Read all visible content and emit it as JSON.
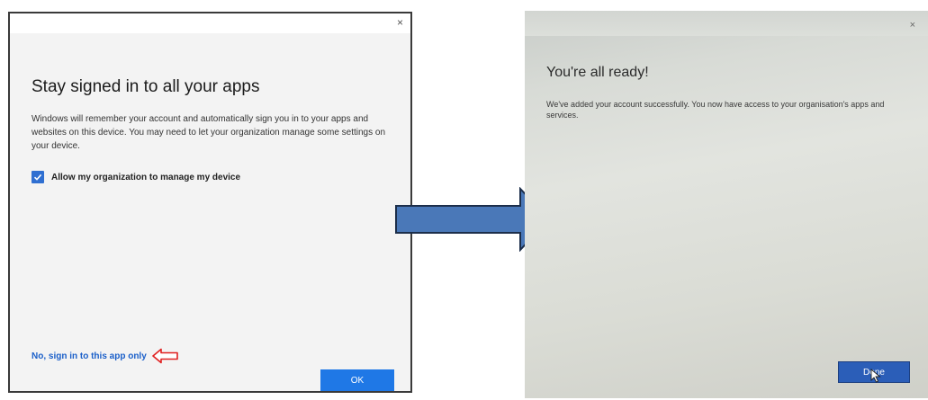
{
  "left_dialog": {
    "close_glyph": "×",
    "title": "Stay signed in to all your apps",
    "description": "Windows will remember your account and automatically sign you in to your apps and websites on this device. You may need to let your organization manage some settings on your device.",
    "checkbox_label": "Allow my organization to manage my device",
    "checkbox_checked": true,
    "link_text": "No, sign in to this app only",
    "ok_label": "OK",
    "accent_color": "#1f78e6",
    "annotation_arrow_color": "#e02020"
  },
  "flow_arrow": {
    "icon": "right-arrow-icon",
    "color": "#4a78b8"
  },
  "right_dialog": {
    "close_glyph": "×",
    "title": "You're all ready!",
    "description": "We've added your account successfully. You now have access to your organisation's apps and services.",
    "done_label": "Done",
    "button_color": "#2b5eb8"
  }
}
